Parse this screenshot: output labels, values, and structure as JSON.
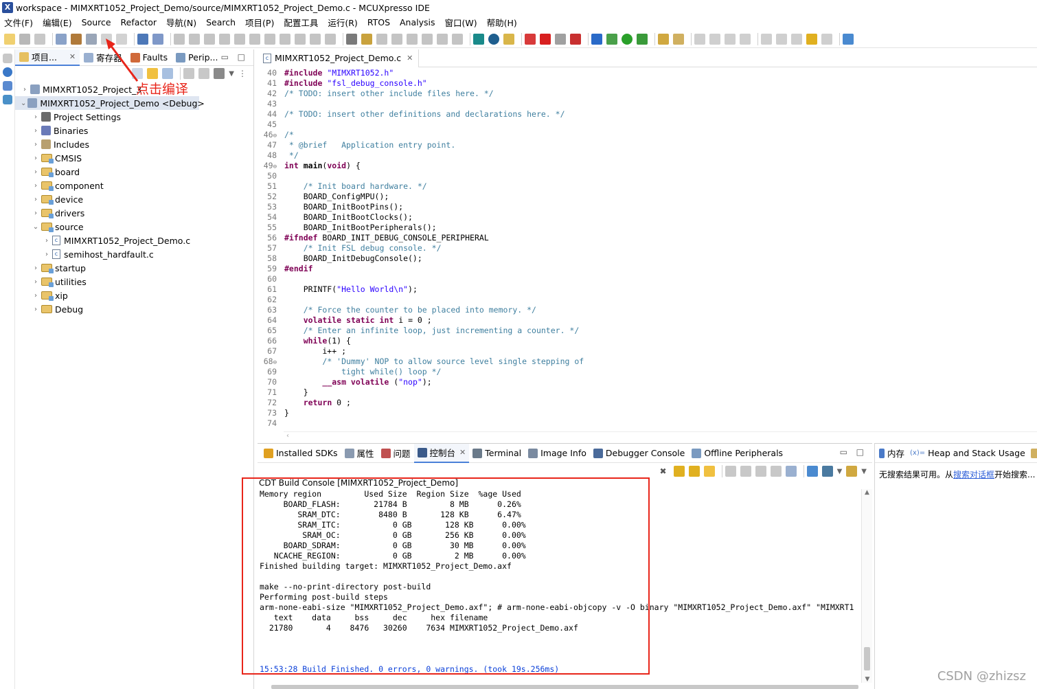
{
  "window": {
    "title": "workspace - MIMXRT1052_Project_Demo/source/MIMXRT1052_Project_Demo.c - MCUXpresso IDE"
  },
  "menu": [
    "文件(F)",
    "编辑(E)",
    "Source",
    "Refactor",
    "导航(N)",
    "Search",
    "项目(P)",
    "配置工具",
    "运行(R)",
    "RTOS",
    "Analysis",
    "窗口(W)",
    "帮助(H)"
  ],
  "project_explorer": {
    "tabs": [
      "项目...",
      "寄存器",
      "Faults",
      "Perip..."
    ],
    "annotation": "点击编译",
    "tree": [
      {
        "label": "MIMXRT1052_Project_3",
        "type": "project"
      },
      {
        "label": "MIMXRT1052_Project_Demo <Debug>",
        "type": "project",
        "expanded": true,
        "selected": true
      },
      {
        "label": "Project Settings",
        "type": "settings"
      },
      {
        "label": "Binaries",
        "type": "binaries"
      },
      {
        "label": "Includes",
        "type": "includes"
      },
      {
        "label": "CMSIS",
        "type": "folder"
      },
      {
        "label": "board",
        "type": "folder"
      },
      {
        "label": "component",
        "type": "folder"
      },
      {
        "label": "device",
        "type": "folder"
      },
      {
        "label": "drivers",
        "type": "folder"
      },
      {
        "label": "source",
        "type": "folder",
        "expanded": true
      },
      {
        "label": "MIMXRT1052_Project_Demo.c",
        "type": "cfile"
      },
      {
        "label": "semihost_hardfault.c",
        "type": "cfile"
      },
      {
        "label": "startup",
        "type": "folder"
      },
      {
        "label": "utilities",
        "type": "folder"
      },
      {
        "label": "xip",
        "type": "folder"
      },
      {
        "label": "Debug",
        "type": "folder"
      }
    ]
  },
  "editor": {
    "tab": "MIMXRT1052_Project_Demo.c",
    "lines": [
      {
        "n": "40",
        "html": "<span class=\"pp\">#include</span> <span class=\"str\">\"MIMXRT1052.h\"</span>"
      },
      {
        "n": "41",
        "html": "<span class=\"pp\">#include</span> <span class=\"str\">\"fsl_debug_console.h\"</span>"
      },
      {
        "n": "42",
        "html": "<span class=\"cm\">/* TODO: insert other include files here. */</span>"
      },
      {
        "n": "43",
        "html": ""
      },
      {
        "n": "44",
        "html": "<span class=\"cm\">/* TODO: insert other definitions and declarations here. */</span>"
      },
      {
        "n": "45",
        "html": ""
      },
      {
        "n": "46",
        "html": "<span class=\"cm\">/*</span>",
        "fold": true
      },
      {
        "n": "47",
        "html": "<span class=\"cm\"> * @brief   Application entry point.</span>"
      },
      {
        "n": "48",
        "html": "<span class=\"cm\"> */</span>"
      },
      {
        "n": "49",
        "html": "<span class=\"kw\">int</span> <b>main</b>(<span class=\"kw\">void</span>) {",
        "fold": true
      },
      {
        "n": "50",
        "html": ""
      },
      {
        "n": "51",
        "html": "    <span class=\"cm\">/* Init board hardware. */</span>"
      },
      {
        "n": "52",
        "html": "    BOARD_ConfigMPU();"
      },
      {
        "n": "53",
        "html": "    BOARD_InitBootPins();"
      },
      {
        "n": "54",
        "html": "    BOARD_InitBootClocks();"
      },
      {
        "n": "55",
        "html": "    BOARD_InitBootPeripherals();"
      },
      {
        "n": "56",
        "html": "<span class=\"pp\">#ifndef</span> BOARD_INIT_DEBUG_CONSOLE_PERIPHERAL"
      },
      {
        "n": "57",
        "html": "    <span class=\"cm\">/* Init FSL debug console. */</span>"
      },
      {
        "n": "58",
        "html": "    BOARD_InitDebugConsole();"
      },
      {
        "n": "59",
        "html": "<span class=\"pp\">#endif</span>"
      },
      {
        "n": "60",
        "html": ""
      },
      {
        "n": "61",
        "html": "    PRINTF(<span class=\"str\">\"Hello World\\n\"</span>);"
      },
      {
        "n": "62",
        "html": ""
      },
      {
        "n": "63",
        "html": "    <span class=\"cm\">/* Force the counter to be placed into memory. */</span>"
      },
      {
        "n": "64",
        "html": "    <span class=\"kw\">volatile</span> <span class=\"kw\">static</span> <span class=\"kw\">int</span> i = 0 ;"
      },
      {
        "n": "65",
        "html": "    <span class=\"cm\">/* Enter an infinite loop, just incrementing a counter. */</span>"
      },
      {
        "n": "66",
        "html": "    <span class=\"kw\">while</span>(1) {"
      },
      {
        "n": "67",
        "html": "        i++ ;"
      },
      {
        "n": "68",
        "html": "        <span class=\"cm\">/* 'Dummy' NOP to allow source level single stepping of</span>",
        "fold": true
      },
      {
        "n": "69",
        "html": "<span class=\"cm\">            tight while() loop */</span>"
      },
      {
        "n": "70",
        "html": "        <span class=\"kw\">__asm volatile</span> (<span class=\"str\">\"nop\"</span>);"
      },
      {
        "n": "71",
        "html": "    }"
      },
      {
        "n": "72",
        "html": "    <span class=\"kw\">return</span> 0 ;"
      },
      {
        "n": "73",
        "html": "}"
      },
      {
        "n": "74",
        "html": ""
      }
    ]
  },
  "bottom_panel": {
    "tabs": [
      "Installed SDKs",
      "属性",
      "问题",
      "控制台",
      "Terminal",
      "Image Info",
      "Debugger Console",
      "Offline Peripherals"
    ],
    "console_title": "CDT Build Console [MIMXRT1052_Project_Demo]",
    "console_lines": [
      "Memory region         Used Size  Region Size  %age Used",
      "     BOARD_FLASH:       21784 B         8 MB      0.26%",
      "        SRAM_DTC:        8480 B       128 KB      6.47%",
      "        SRAM_ITC:           0 GB       128 KB      0.00%",
      "         SRAM_OC:           0 GB       256 KB      0.00%",
      "     BOARD_SDRAM:           0 GB        30 MB      0.00%",
      "   NCACHE_REGION:           0 GB         2 MB      0.00%",
      "Finished building target: MIMXRT1052_Project_Demo.axf",
      "",
      "make --no-print-directory post-build",
      "Performing post-build steps",
      "arm-none-eabi-size \"MIMXRT1052_Project_Demo.axf\"; # arm-none-eabi-objcopy -v -O binary \"MIMXRT1052_Project_Demo.axf\" \"MIMXRT1",
      "   text    data     bss     dec     hex filename",
      "  21780       4    8476   30260    7634 MIMXRT1052_Project_Demo.axf",
      "",
      "",
      "",
      "15:53:28 Build Finished. 0 errors, 0 warnings. (took 19s.256ms)"
    ]
  },
  "right_panel": {
    "tabs": [
      "内存",
      "Heap and Stack Usage"
    ],
    "message_prefix": "无搜索结果可用。从",
    "message_link": "搜索对话框",
    "message_suffix": "开始搜索..."
  },
  "watermark": "CSDN @zhizsz",
  "colors": {
    "annotation_red": "#e8251a",
    "keyword": "#7f0055",
    "string": "#2a00ff",
    "comment": "#3f7f9f",
    "build_finished": "#0a3fd8"
  }
}
